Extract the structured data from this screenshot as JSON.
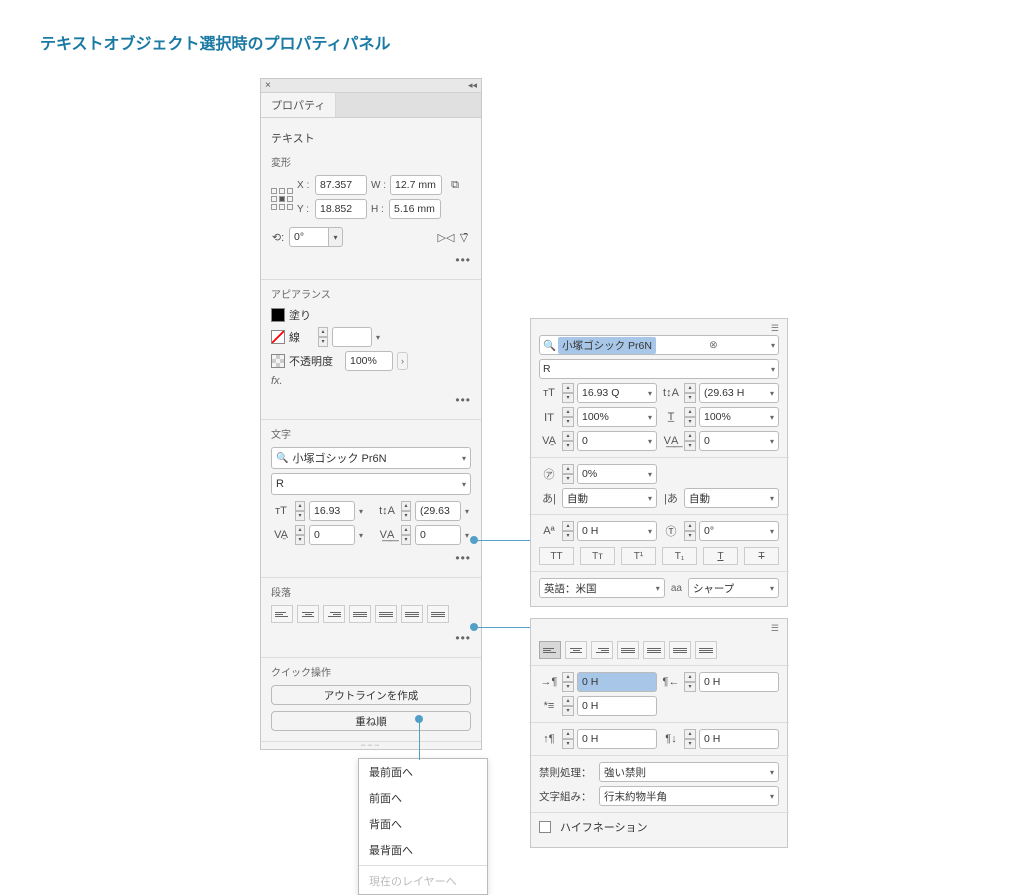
{
  "page_title": "テキストオブジェクト選択時のプロパティパネル",
  "panel": {
    "tab": "プロパティ",
    "objtype": "テキスト",
    "transform": {
      "label": "変形",
      "x_label": "X :",
      "x": "87.357",
      "y_label": "Y :",
      "y": "18.852",
      "w_label": "W :",
      "w": "12.7 mm",
      "h_label": "H :",
      "h": "5.16 mm",
      "rotate": "0°"
    },
    "appearance": {
      "label": "アピアランス",
      "fill": "塗り",
      "stroke": "線",
      "opacity_label": "不透明度",
      "opacity": "100%",
      "fx": "fx."
    },
    "character": {
      "label": "文字",
      "font": "小塚ゴシック Pr6N",
      "style": "R",
      "size": "16.93",
      "leading": "(29.63",
      "kerning": "0",
      "tracking": "0"
    },
    "paragraph": {
      "label": "段落"
    },
    "quick": {
      "label": "クイック操作",
      "outline": "アウトラインを作成",
      "arrange": "重ね順"
    }
  },
  "arrange_menu": {
    "front": "最前面へ",
    "forward": "前面へ",
    "backward": "背面へ",
    "back": "最背面へ",
    "current_layer": "現在のレイヤーへ"
  },
  "char_panel": {
    "font": "小塚ゴシック Pr6N",
    "style": "R",
    "size": "16.93 Q",
    "leading": "(29.63 H",
    "vscale": "100%",
    "hscale": "100%",
    "kerning": "0",
    "tracking": "0",
    "tsume": "0%",
    "aki_before": "自動",
    "aki_after": "自動",
    "baseline": "0 H",
    "rotate": "0°",
    "lang_label": "英語：米国",
    "aa_label_short": "aa",
    "aa": "シャープ"
  },
  "para_panel": {
    "indent_left": "0 H",
    "indent_right": "0 H",
    "indent_first": "0 H",
    "space_before": "0 H",
    "space_after": "0 H",
    "kinsoku_label": "禁則処理：",
    "kinsoku": "強い禁則",
    "mojikumi_label": "文字組み：",
    "mojikumi": "行末約物半角",
    "hyphenation": "ハイフネーション"
  }
}
